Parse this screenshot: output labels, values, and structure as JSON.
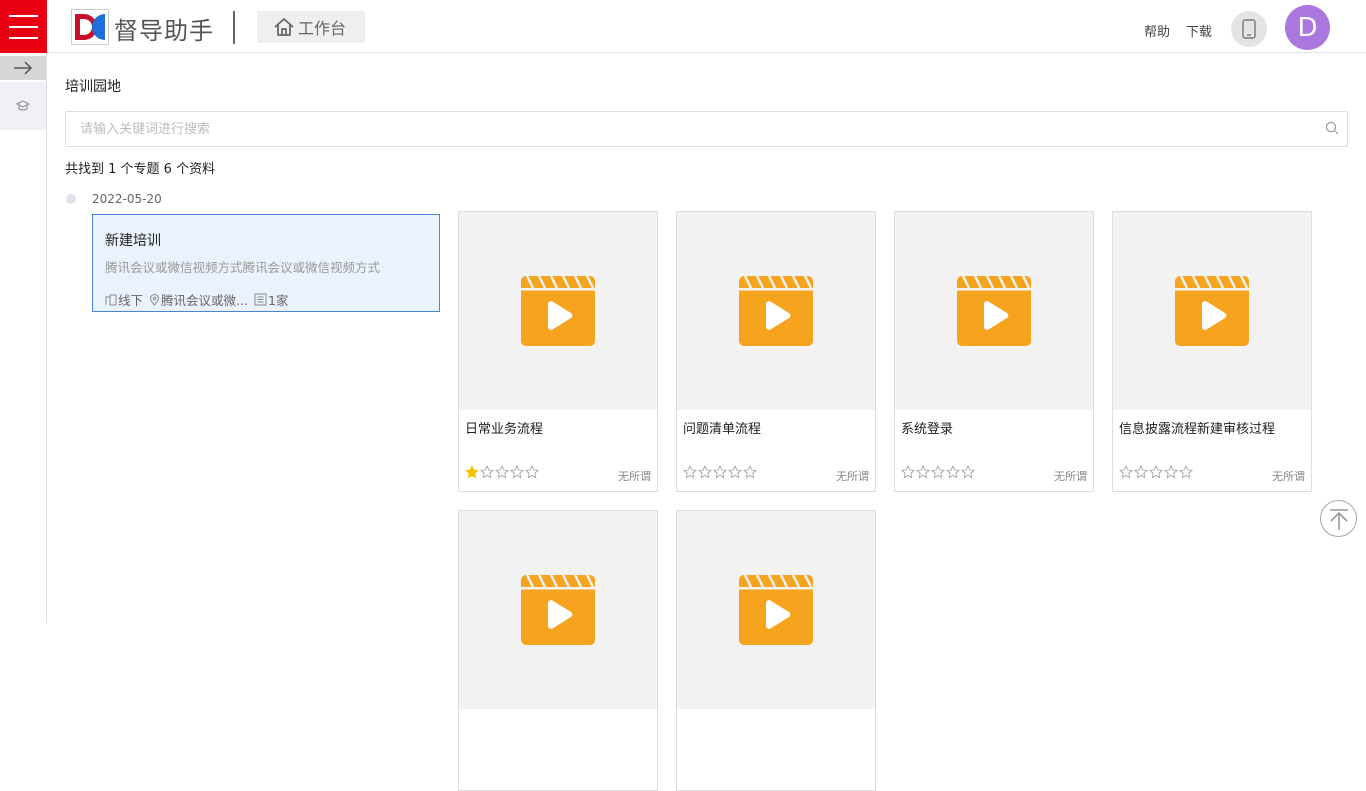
{
  "header": {
    "app_title": "督导助手",
    "workbench_label": "工作台",
    "links": [
      "帮助",
      "下载"
    ],
    "avatar_letter": "D",
    "brand_color": "#e60012",
    "avatar_color": "#a977dd"
  },
  "sidebar": {
    "collapse_icon": "arrow-right-icon",
    "items": [
      {
        "icon": "graduation-cap-icon"
      }
    ]
  },
  "main": {
    "title": "培训园地",
    "search": {
      "placeholder": "请输入关键词进行搜索",
      "value": ""
    },
    "summary": "共找到 1 个专题 6 个资料",
    "date": "2022-05-20",
    "topic": {
      "title": "新建培训",
      "description": "腾讯会议或微信视频方式腾讯会议或微信视频方式",
      "mode": "线下",
      "location": "腾讯会议或微...",
      "count": "1家"
    },
    "cards": [
      {
        "title": "日常业务流程",
        "rating": 1,
        "tag": "无所谓"
      },
      {
        "title": "问题清单流程",
        "rating": 0,
        "tag": "无所谓"
      },
      {
        "title": "系统登录",
        "rating": 0,
        "tag": "无所谓"
      },
      {
        "title": "信息披露流程新建审核过程",
        "rating": 0,
        "tag": "无所谓"
      },
      {
        "title": "",
        "rating": 0,
        "tag": ""
      },
      {
        "title": "",
        "rating": 0,
        "tag": ""
      }
    ],
    "video_icon_color": "#f6a31d"
  }
}
